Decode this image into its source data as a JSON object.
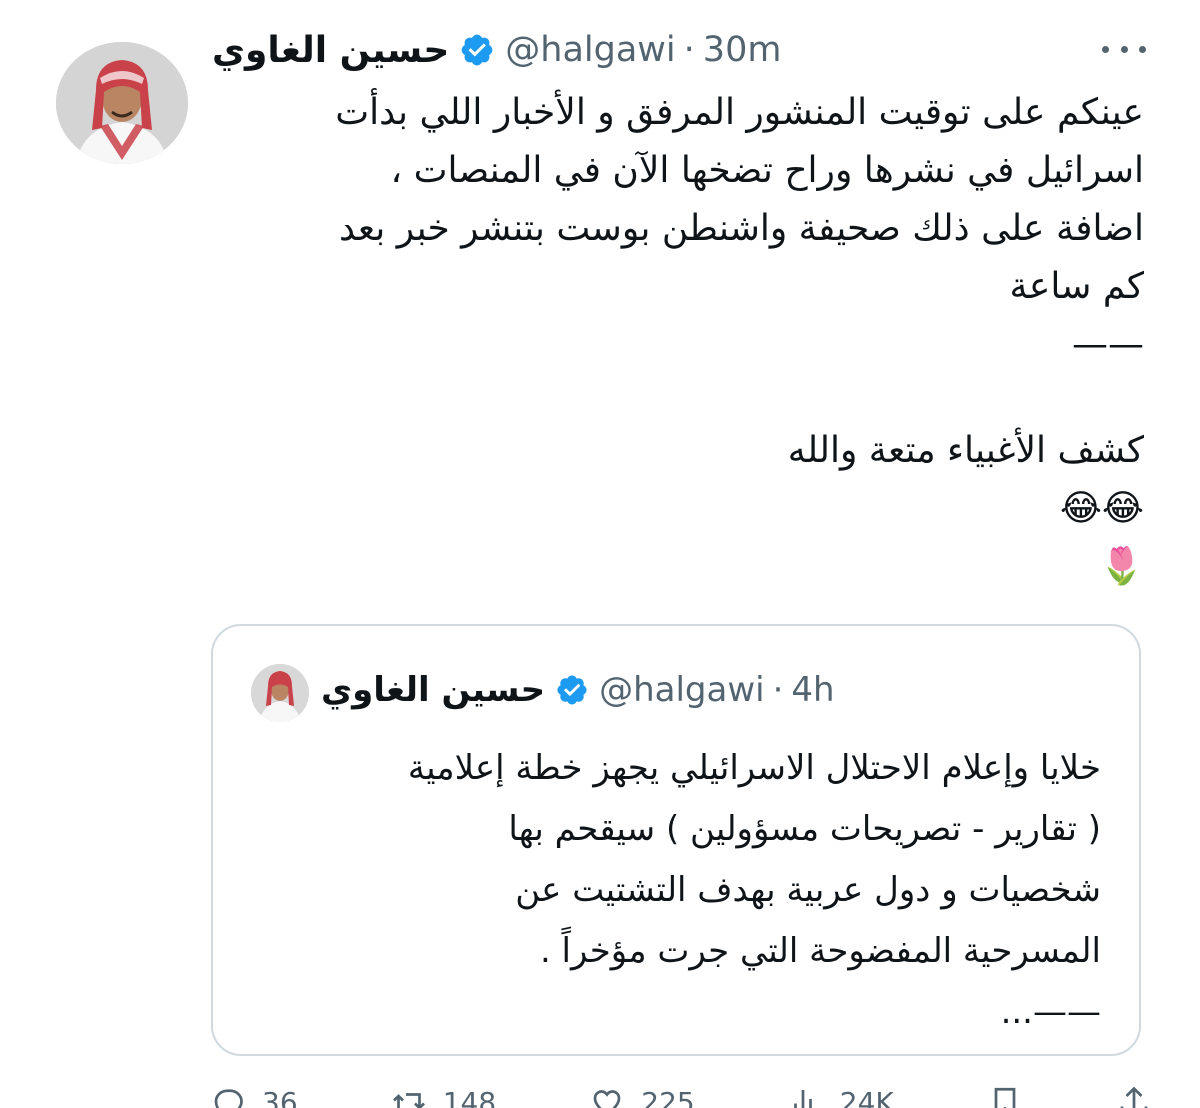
{
  "tweet": {
    "author_name": "حسين الغاوي",
    "handle": "@halgawi",
    "separator": "·",
    "time": "30m",
    "lines": [
      "عينكم على توقيت المنشور المرفق و الأخبار اللي بدأت",
      "اسرائيل في نشرها وراح تضخها الآن في المنصات ،",
      "اضافة على ذلك صحيفة واشنطن بوست بتنشر خبر بعد",
      "كم ساعة",
      "——",
      "كشف الأغبياء متعة والله",
      "😂😂",
      "🌷"
    ]
  },
  "quoted_tweet": {
    "author_name": "حسين الغاوي",
    "handle": "@halgawi",
    "separator": "·",
    "time": "4h",
    "lines": [
      "خلايا وإعلام الاحتلال الاسرائيلي يجهز خطة إعلامية",
      "( تقارير - تصريحات مسؤولين ) سيقحم بها",
      "شخصيات و دول عربية بهدف التشتيت عن",
      "المسرحية المفضوحة التي جرت مؤخراً .",
      "——..."
    ]
  },
  "actions": {
    "replies": "36",
    "reposts": "148",
    "likes": "225",
    "views": "24K"
  },
  "icons": {
    "verified": "verified-badge-icon",
    "more": "more-icon",
    "reply": "reply-icon",
    "repost": "repost-icon",
    "like": "heart-icon",
    "views": "views-icon",
    "bookmark": "bookmark-icon",
    "share": "share-icon"
  },
  "colors": {
    "verified": "#1d9bf0",
    "secondary_text": "#536471",
    "border": "#cfd9de"
  }
}
